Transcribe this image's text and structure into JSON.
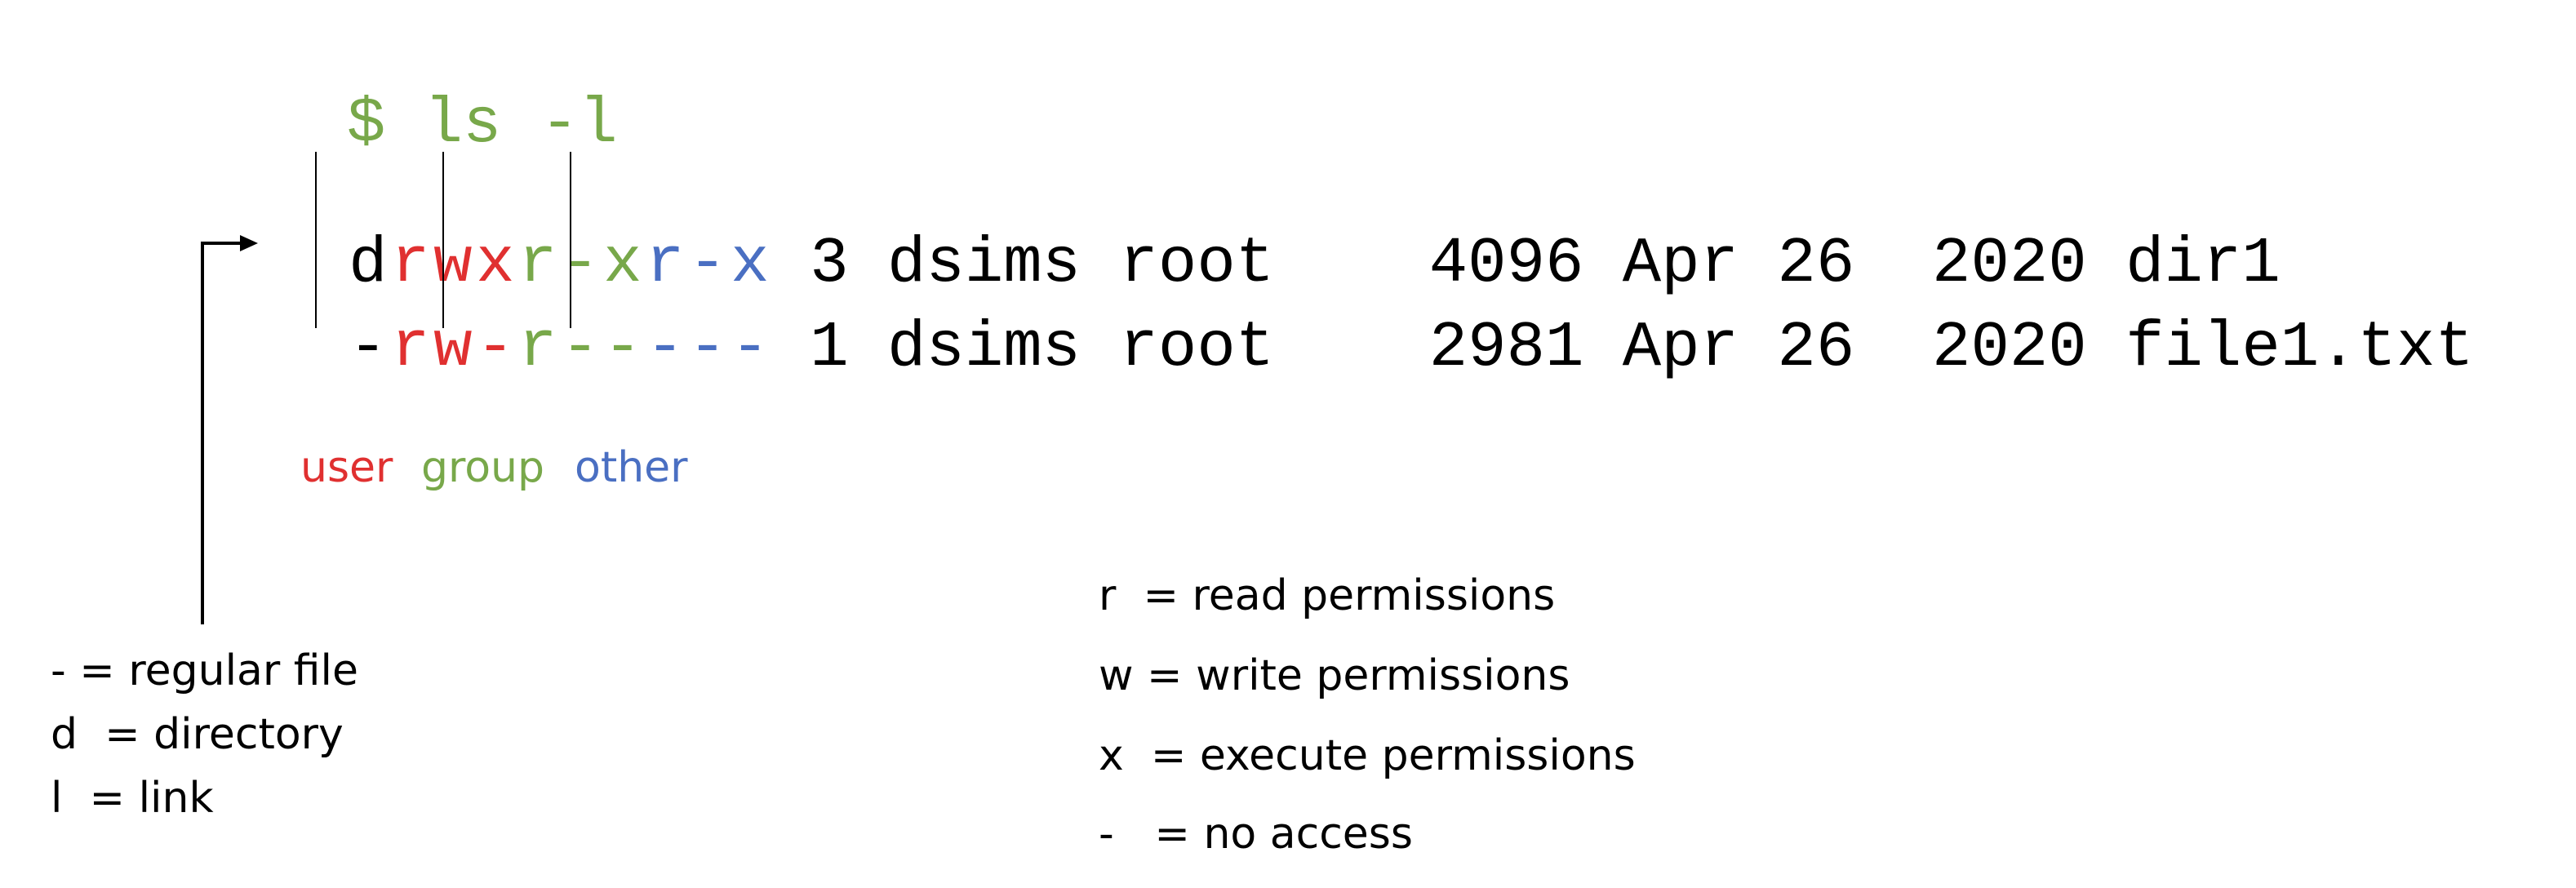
{
  "command": "$ ls -l",
  "colors": {
    "user": "#e03030",
    "group": "#78a84a",
    "other": "#4a6fc2",
    "command": "#78a84a",
    "text": "#000000"
  },
  "listing": [
    {
      "type": "d",
      "user": [
        "r",
        "w",
        "x"
      ],
      "group": [
        "r",
        "-",
        "x"
      ],
      "other": [
        "r",
        "-",
        "x"
      ],
      "details": " 3 dsims root    4096 Apr 26  2020 dir1"
    },
    {
      "type": "-",
      "user": [
        "r",
        "w",
        "-"
      ],
      "group": [
        "r",
        "-",
        "-"
      ],
      "other": [
        "-",
        "-",
        "-"
      ],
      "details": " 1 dsims root    2981 Apr 26  2020 file1.txt"
    }
  ],
  "permission_labels": {
    "user": "user",
    "group": "group",
    "other": "other"
  },
  "file_type_legend": [
    "- = regular file",
    "d  = directory",
    "l  = link"
  ],
  "permission_legend": [
    "r  = read permissions",
    "w = write permissions",
    "x  = execute permissions",
    "-   = no access"
  ]
}
